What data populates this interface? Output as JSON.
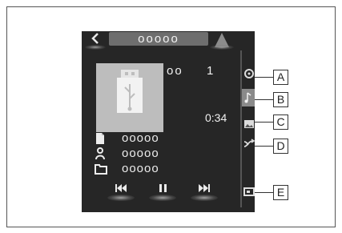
{
  "header": {
    "back_icon": "chevron-left-icon",
    "title": "ooooo",
    "peak_icon": "up-triangle-icon"
  },
  "now_playing": {
    "artwork_icon": "usb-drive-icon",
    "track_label": "oo",
    "track_number": "1",
    "time": "0:34",
    "details": [
      {
        "icon": "file-icon",
        "text": "ooooo"
      },
      {
        "icon": "person-icon",
        "text": "ooooo"
      },
      {
        "icon": "folder-icon",
        "text": "ooooo"
      }
    ]
  },
  "controls": {
    "prev_symbol": "⏮",
    "pause_symbol": "⏸",
    "next_symbol": "⏭"
  },
  "side_menu": [
    {
      "icon": "source-icon",
      "callout": "A"
    },
    {
      "icon": "music-note-icon",
      "callout": "B"
    },
    {
      "icon": "picture-icon",
      "callout": "C"
    },
    {
      "icon": "shuffle-repeat-icon",
      "callout": "D"
    },
    {
      "icon": "screen-icon",
      "callout": "E"
    }
  ],
  "colors": {
    "screen_bg": "#262626",
    "artwork_bg": "#bdbdbd",
    "pill_bg": "#6e6e6e",
    "active_side_bg": "#8a8a8a"
  }
}
